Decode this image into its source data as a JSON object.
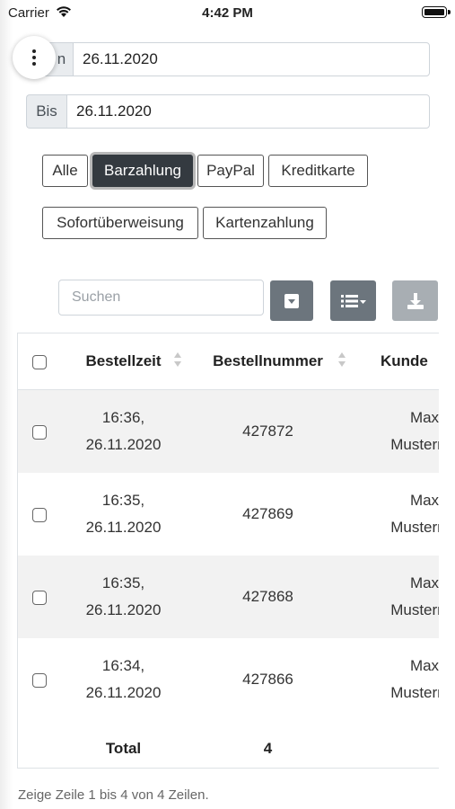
{
  "status_bar": {
    "carrier": "Carrier",
    "time": "4:42 PM"
  },
  "filter": {
    "von_label": "Von",
    "von_visible": "n",
    "von_value": "26.11.2020",
    "bis_label": "Bis",
    "bis_value": "26.11.2020"
  },
  "payment_filters": [
    {
      "label": "Alle",
      "active": false
    },
    {
      "label": "Barzahlung",
      "active": true
    },
    {
      "label": "PayPal",
      "active": false
    },
    {
      "label": "Kreditkarte",
      "active": false
    },
    {
      "label": "Sofortüberweisung",
      "active": false
    },
    {
      "label": "Kartenzahlung",
      "active": false
    }
  ],
  "toolbar": {
    "search_placeholder": "Suchen"
  },
  "table": {
    "columns": [
      "Bestellzeit",
      "Bestellnummer",
      "Kunde"
    ],
    "rows": [
      {
        "time": "16:36,",
        "date": "26.11.2020",
        "order": "427872",
        "customer_first": "Max",
        "customer_last": "Musterma"
      },
      {
        "time": "16:35,",
        "date": "26.11.2020",
        "order": "427869",
        "customer_first": "Max",
        "customer_last": "Musterma"
      },
      {
        "time": "16:35,",
        "date": "26.11.2020",
        "order": "427868",
        "customer_first": "Max",
        "customer_last": "Musterma"
      },
      {
        "time": "16:34,",
        "date": "26.11.2020",
        "order": "427866",
        "customer_first": "Max",
        "customer_last": "Musterma"
      }
    ],
    "total_label": "Total",
    "total_value": "4"
  },
  "pagination_text": "Zeige Zeile 1 bis 4 von 4 Zeilen."
}
